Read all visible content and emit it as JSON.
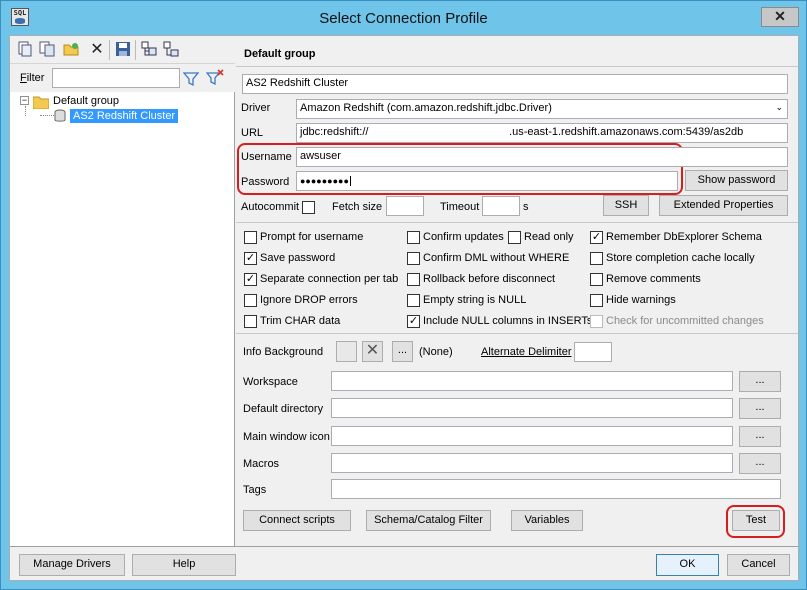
{
  "window": {
    "title": "Select Connection Profile",
    "close_glyph": "✕",
    "app_icon_text": "SQL"
  },
  "toolbar": {
    "icons": [
      "new-profile-icon",
      "copy-profile-icon",
      "new-folder-icon",
      "delete-icon",
      "save-icon",
      "expand-icon",
      "collapse-icon"
    ]
  },
  "filter": {
    "label": "Filter",
    "value": ""
  },
  "tree": {
    "group": "Default group",
    "profile": "AS2 Redshift Cluster"
  },
  "profile": {
    "group_header": "Default group",
    "name": "AS2 Redshift Cluster",
    "driver_label": "Driver",
    "driver_value": "Amazon Redshift (com.amazon.redshift.jdbc.Driver)",
    "url_label": "URL",
    "url_value": "jdbc:redshift://                                              .us-east-1.redshift.amazonaws.com:5439/as2db",
    "username_label": "Username",
    "username_value": "awsuser",
    "password_label": "Password",
    "password_value": "●●●●●●●●●",
    "show_password": "Show password",
    "autocommit_label": "Autocommit",
    "fetch_size_label": "Fetch size",
    "fetch_size_value": "",
    "timeout_label": "Timeout",
    "timeout_value": "",
    "timeout_unit": "s",
    "ssh_button": "SSH",
    "extended_props_button": "Extended Properties"
  },
  "options": {
    "col1": [
      {
        "label": "Prompt for username",
        "checked": false
      },
      {
        "label": "Save password",
        "checked": true
      },
      {
        "label": "Separate connection per tab",
        "checked": true
      },
      {
        "label": "Ignore DROP errors",
        "checked": false
      },
      {
        "label": "Trim CHAR data",
        "checked": false
      }
    ],
    "col2": [
      {
        "label": "Confirm updates",
        "checked": false
      },
      {
        "label": "Confirm DML without WHERE",
        "checked": false
      },
      {
        "label": "Rollback before disconnect",
        "checked": false
      },
      {
        "label": "Empty string is NULL",
        "checked": false
      },
      {
        "label": "Include NULL columns in INSERTs",
        "checked": true
      }
    ],
    "read_only": {
      "label": "Read only",
      "checked": false
    },
    "col3": [
      {
        "label": "Remember DbExplorer Schema",
        "checked": true
      },
      {
        "label": "Store completion cache locally",
        "checked": false
      },
      {
        "label": "Remove comments",
        "checked": false
      },
      {
        "label": "Hide warnings",
        "checked": false
      },
      {
        "label": "Check for uncommitted changes",
        "checked": false,
        "disabled": true
      }
    ]
  },
  "extra": {
    "info_background_label": "Info Background",
    "info_background_value": "(None)",
    "alternate_delimiter_label": "Alternate Delimiter",
    "alternate_delimiter_value": "",
    "workspace_label": "Workspace",
    "default_directory_label": "Default directory",
    "main_window_icon_label": "Main window icon",
    "macros_label": "Macros",
    "tags_label": "Tags",
    "browse_label": "...",
    "connect_scripts": "Connect scripts",
    "schema_filter": "Schema/Catalog Filter",
    "variables": "Variables",
    "test": "Test"
  },
  "footer": {
    "manage_drivers": "Manage Drivers",
    "help": "Help",
    "ok": "OK",
    "cancel": "Cancel"
  },
  "colors": {
    "titlebar": "#6fc4ea",
    "selection": "#3399ff",
    "highlight_box": "#d61e1e"
  }
}
